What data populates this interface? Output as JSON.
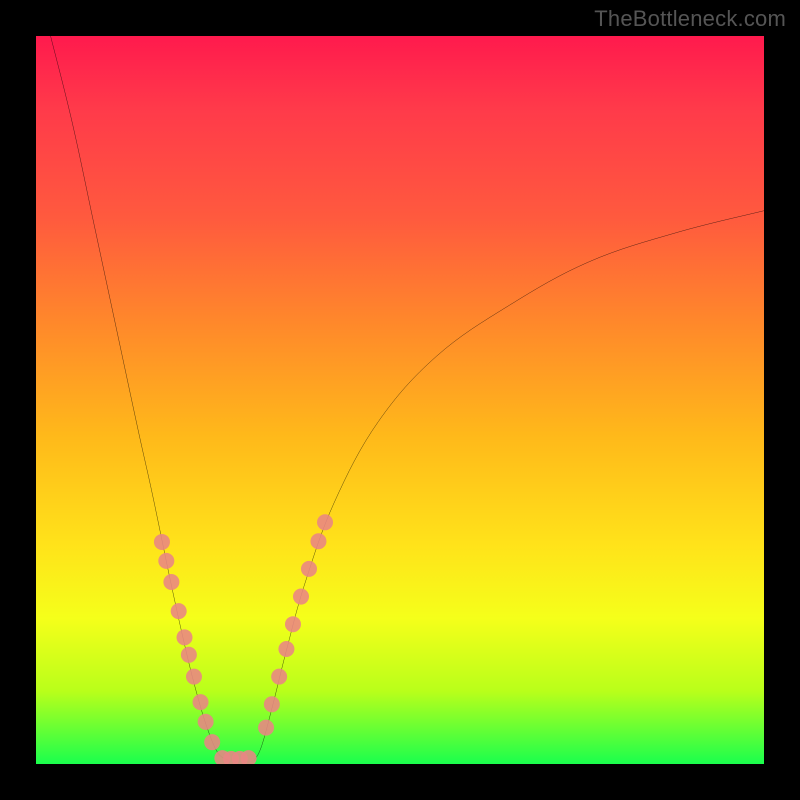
{
  "watermark": "TheBottleneck.com",
  "chart_data": {
    "type": "line",
    "title": "",
    "xlabel": "",
    "ylabel": "",
    "xlim": [
      0,
      100
    ],
    "ylim": [
      0,
      100
    ],
    "note": "Axes are unlabeled in the source image; x and y are normalized 0–100 from plot-area left/bottom.",
    "background_gradient": {
      "direction": "top-to-bottom",
      "stops": [
        {
          "pct": 0,
          "color": "#ff1a4d"
        },
        {
          "pct": 10,
          "color": "#ff3a4a"
        },
        {
          "pct": 25,
          "color": "#ff5a3e"
        },
        {
          "pct": 40,
          "color": "#ff8a2a"
        },
        {
          "pct": 55,
          "color": "#ffb91a"
        },
        {
          "pct": 70,
          "color": "#ffe31a"
        },
        {
          "pct": 80,
          "color": "#f5ff1a"
        },
        {
          "pct": 90,
          "color": "#b9ff1a"
        },
        {
          "pct": 100,
          "color": "#1aff4d"
        }
      ]
    },
    "series": [
      {
        "name": "left-curve",
        "stroke": "#000000",
        "points": [
          {
            "x": 2.0,
            "y": 100.0
          },
          {
            "x": 5.0,
            "y": 88.0
          },
          {
            "x": 8.0,
            "y": 74.0
          },
          {
            "x": 11.0,
            "y": 60.0
          },
          {
            "x": 14.0,
            "y": 46.0
          },
          {
            "x": 16.0,
            "y": 37.0
          },
          {
            "x": 18.5,
            "y": 25.0
          },
          {
            "x": 20.5,
            "y": 16.0
          },
          {
            "x": 22.0,
            "y": 10.0
          },
          {
            "x": 23.5,
            "y": 5.0
          },
          {
            "x": 25.0,
            "y": 1.5
          },
          {
            "x": 26.5,
            "y": 0.5
          }
        ]
      },
      {
        "name": "right-curve",
        "stroke": "#000000",
        "points": [
          {
            "x": 30.0,
            "y": 0.5
          },
          {
            "x": 31.0,
            "y": 2.5
          },
          {
            "x": 32.5,
            "y": 8.0
          },
          {
            "x": 34.5,
            "y": 16.0
          },
          {
            "x": 37.0,
            "y": 25.0
          },
          {
            "x": 41.0,
            "y": 36.0
          },
          {
            "x": 47.0,
            "y": 47.0
          },
          {
            "x": 55.0,
            "y": 56.0
          },
          {
            "x": 65.0,
            "y": 63.0
          },
          {
            "x": 76.0,
            "y": 69.0
          },
          {
            "x": 88.0,
            "y": 73.0
          },
          {
            "x": 100.0,
            "y": 76.0
          }
        ]
      }
    ],
    "markers": {
      "color": "#e98584",
      "radius_pct": 1.1,
      "left_branch": [
        {
          "x": 17.3,
          "y": 30.5
        },
        {
          "x": 17.9,
          "y": 27.9
        },
        {
          "x": 18.6,
          "y": 25.0
        },
        {
          "x": 19.6,
          "y": 21.0
        },
        {
          "x": 20.4,
          "y": 17.4
        },
        {
          "x": 21.0,
          "y": 15.0
        },
        {
          "x": 21.7,
          "y": 12.0
        },
        {
          "x": 22.6,
          "y": 8.5
        },
        {
          "x": 23.3,
          "y": 5.8
        },
        {
          "x": 24.2,
          "y": 3.0
        }
      ],
      "bottom_cluster": [
        {
          "x": 25.6,
          "y": 0.8
        },
        {
          "x": 26.8,
          "y": 0.7
        },
        {
          "x": 28.0,
          "y": 0.7
        },
        {
          "x": 29.2,
          "y": 0.8
        }
      ],
      "right_branch": [
        {
          "x": 31.6,
          "y": 5.0
        },
        {
          "x": 32.4,
          "y": 8.2
        },
        {
          "x": 33.4,
          "y": 12.0
        },
        {
          "x": 34.4,
          "y": 15.8
        },
        {
          "x": 35.3,
          "y": 19.2
        },
        {
          "x": 36.4,
          "y": 23.0
        },
        {
          "x": 37.5,
          "y": 26.8
        },
        {
          "x": 38.8,
          "y": 30.6
        },
        {
          "x": 39.7,
          "y": 33.2
        }
      ]
    }
  }
}
